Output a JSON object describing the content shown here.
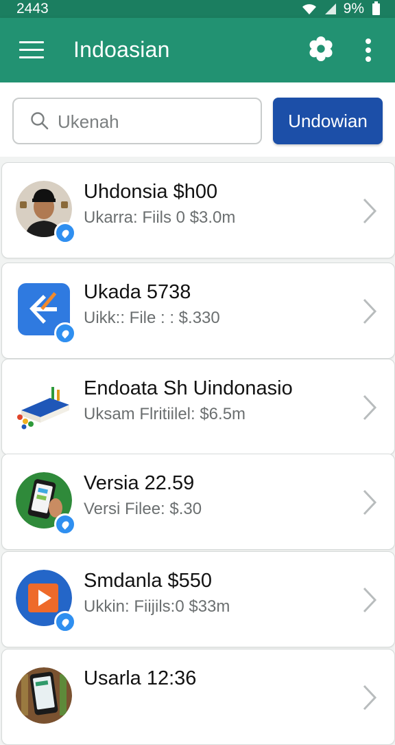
{
  "status_bar": {
    "time": "2443",
    "battery": "9%"
  },
  "app_bar": {
    "title": "Indoasian",
    "icons": [
      "menu-icon",
      "settings-icon",
      "more-vert-icon"
    ]
  },
  "search": {
    "placeholder": "Ukenah",
    "button_label": "Undowian"
  },
  "list": {
    "items": [
      {
        "title": "Uhdonsia $h00",
        "subtitle": "Ukarra: Fiils 0  $3.0m",
        "icon": "person-avatar-icon",
        "verified": true
      },
      {
        "title": "Ukada 5738",
        "subtitle": "Uikk:: File : : $.330",
        "icon": "app-tile-icon",
        "verified": true
      },
      {
        "title": "Endoata Sh Uindonasio",
        "subtitle": "Uksam Flritiilel: $6.5m",
        "icon": "book-icon",
        "verified": false
      },
      {
        "title": "Versia 22.59",
        "subtitle": "Versi  Filee: $.30",
        "icon": "phone-app-icon",
        "verified": true
      },
      {
        "title": "Smdanla $550",
        "subtitle": "Ukkin: Fiijils:0  $33m",
        "icon": "play-icon",
        "verified": true
      },
      {
        "title": "Usarla 12:36",
        "subtitle": "",
        "icon": "phone-hand-icon",
        "verified": false
      }
    ]
  },
  "colors": {
    "status_bar": "#1b7e60",
    "app_bar": "#229272",
    "primary_button": "#1c4fa8",
    "verified_badge": "#2f8ff0"
  }
}
